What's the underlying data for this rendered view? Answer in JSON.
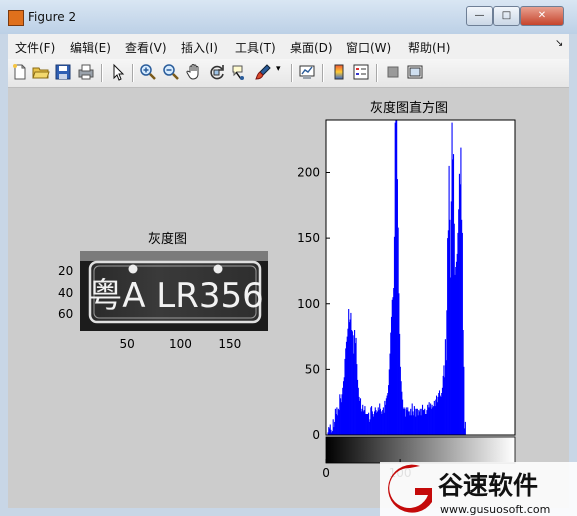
{
  "window": {
    "title": "Figure 2",
    "controls": {
      "minimize": "—",
      "maximize": "□",
      "close": "✕"
    }
  },
  "menu": [
    "文件(F)",
    "编辑(E)",
    "查看(V)",
    "插入(I)",
    "工具(T)",
    "桌面(D)",
    "窗口(W)",
    "帮助(H)"
  ],
  "toolbar_icons": [
    "new-figure-icon",
    "open-file-icon",
    "save-icon",
    "print-icon",
    "select-arrow-icon",
    "zoom-in-icon",
    "zoom-out-icon",
    "pan-hand-icon",
    "rotate-3d-icon",
    "data-cursor-icon",
    "brush-icon",
    "brush-dropdown-icon",
    "link-plot-icon",
    "colorbar-icon",
    "legend-icon",
    "hide-plot-tools-icon",
    "show-plot-tools-icon"
  ],
  "plate": {
    "title": "灰度图",
    "text": "粤A LR356",
    "x_ticks": [
      "50",
      "100",
      "150"
    ],
    "y_ticks": [
      "20",
      "40",
      "60"
    ],
    "xlim": [
      0,
      190
    ],
    "ylim": [
      0,
      75
    ],
    "x_tick_values": [
      50,
      100,
      150
    ],
    "y_tick_values": [
      20,
      40,
      60
    ]
  },
  "chart_data": {
    "type": "bar",
    "title": "灰度图直方图",
    "xlabel": "",
    "ylabel": "",
    "xlim": [
      0,
      255
    ],
    "ylim": [
      0,
      240
    ],
    "x_tick_labels": [
      "0",
      "100"
    ],
    "y_tick_labels": [
      "0",
      "50",
      "100",
      "150",
      "200"
    ],
    "y_tick_values": [
      0,
      50,
      100,
      150,
      200
    ],
    "x_tick_values": [
      0,
      100
    ],
    "color": "#0000ff",
    "colorbar": "gray",
    "bins": 256,
    "values": [
      0,
      0,
      2,
      6,
      5,
      8,
      4,
      2,
      3,
      12,
      6,
      10,
      20,
      16,
      21,
      15,
      20,
      19,
      31,
      28,
      25,
      31,
      36,
      41,
      44,
      58,
      66,
      71,
      75,
      81,
      96,
      86,
      88,
      93,
      80,
      79,
      76,
      62,
      80,
      70,
      74,
      54,
      42,
      36,
      29,
      26,
      28,
      18,
      20,
      23,
      18,
      19,
      22,
      16,
      16,
      16,
      16,
      17,
      10,
      12,
      21,
      22,
      18,
      16,
      14,
      18,
      21,
      19,
      17,
      18,
      21,
      19,
      24,
      20,
      18,
      16,
      19,
      21,
      17,
      26,
      23,
      28,
      30,
      32,
      38,
      50,
      62,
      78,
      90,
      103,
      105,
      112,
      151,
      238,
      252,
      240,
      195,
      158,
      108,
      77,
      52,
      41,
      33,
      27,
      20,
      21,
      20,
      14,
      21,
      19,
      21,
      18,
      18,
      15,
      20,
      15,
      24,
      18,
      15,
      22,
      20,
      14,
      20,
      20,
      15,
      19,
      18,
      20,
      15,
      20,
      23,
      19,
      19,
      20,
      16,
      16,
      19,
      23,
      21,
      25,
      21,
      24,
      20,
      23,
      21,
      22,
      26,
      22,
      27,
      30,
      25,
      29,
      32,
      34,
      30,
      29,
      32,
      36,
      45,
      53,
      44,
      73,
      57,
      95,
      150,
      156,
      205,
      164,
      120,
      178,
      238,
      210,
      214,
      161,
      122,
      128,
      132,
      138,
      154,
      172,
      199,
      191,
      219,
      164,
      154,
      80,
      52,
      5,
      10,
      0,
      0,
      0,
      0,
      0,
      0,
      0,
      0,
      0,
      0,
      0,
      0,
      0,
      0,
      0,
      0,
      0,
      0,
      0,
      0,
      0,
      0,
      0,
      0,
      0,
      0,
      0,
      0,
      0,
      0,
      0,
      0,
      0,
      0,
      0,
      0,
      0,
      0,
      0,
      0,
      0,
      0,
      0,
      0,
      0,
      0,
      0,
      0,
      0,
      0,
      0,
      0,
      0,
      0,
      0,
      0,
      0,
      0,
      0,
      0,
      0,
      0,
      0
    ]
  },
  "watermark": {
    "brand": "谷速软件",
    "url": "www.gusuosoft.com",
    "logo_letter": "G",
    "color": "#c40a0a"
  }
}
